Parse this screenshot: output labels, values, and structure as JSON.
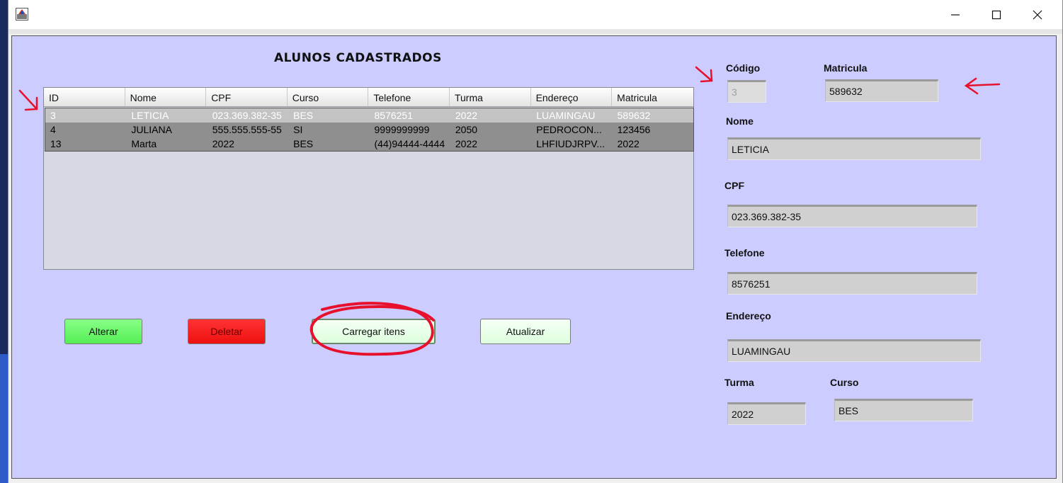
{
  "window": {
    "title": ""
  },
  "heading": "ALUNOS CADASTRADOS",
  "table": {
    "columns": [
      "ID",
      "Nome",
      "CPF",
      "Curso",
      "Telefone",
      "Turma",
      "Endereço",
      "Matricula"
    ],
    "rows": [
      [
        "3",
        "LETICIA",
        "023.369.382-35",
        "BES",
        "8576251",
        "2022",
        "LUAMINGAU",
        "589632"
      ],
      [
        "4",
        "JULIANA",
        "555.555.555-55",
        "SI",
        "9999999999",
        "2050",
        "PEDROCON...",
        "123456"
      ],
      [
        "13",
        "Marta",
        "2022",
        "BES",
        "(44)94444-4444",
        "2022",
        "LHFIUDJRPV...",
        "2022"
      ]
    ],
    "selected_row": 0
  },
  "buttons": {
    "alterar": "Alterar",
    "deletar": "Deletar",
    "carregar": "Carregar itens",
    "atualizar": "Atualizar"
  },
  "form": {
    "codigo_label": "Código",
    "codigo_value": "3",
    "matricula_label": "Matricula",
    "matricula_value": "589632",
    "nome_label": "Nome",
    "nome_value": "LETICIA",
    "cpf_label": "CPF",
    "cpf_value": "023.369.382-35",
    "telefone_label": "Telefone",
    "telefone_value": "8576251",
    "endereco_label": "Endereço",
    "endereco_value": "LUAMINGAU",
    "turma_label": "Turma",
    "turma_value": "2022",
    "curso_label": "Curso",
    "curso_value": "BES"
  },
  "colors": {
    "panel_bg": "#ccccff",
    "annotation_red": "#e8112d",
    "btn_alterar": "#66ff66",
    "btn_deletar": "#ff1a1a"
  },
  "icons": {
    "app": "java-app-icon",
    "minimize": "minimize-icon",
    "maximize": "maximize-icon",
    "close": "close-icon"
  }
}
